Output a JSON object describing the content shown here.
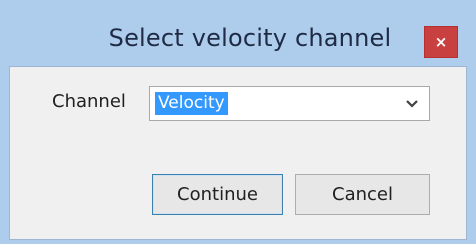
{
  "dialog": {
    "title": "Select velocity channel",
    "close_glyph": "×"
  },
  "channel": {
    "label": "Channel",
    "selected_value": "Velocity",
    "arrow_icon": "chevron-down-icon"
  },
  "buttons": {
    "continue_label": "Continue",
    "cancel_label": "Cancel"
  },
  "colors": {
    "selection_highlight": "#3399ff",
    "close_button": "#c94040",
    "frame": "#aecdec"
  }
}
